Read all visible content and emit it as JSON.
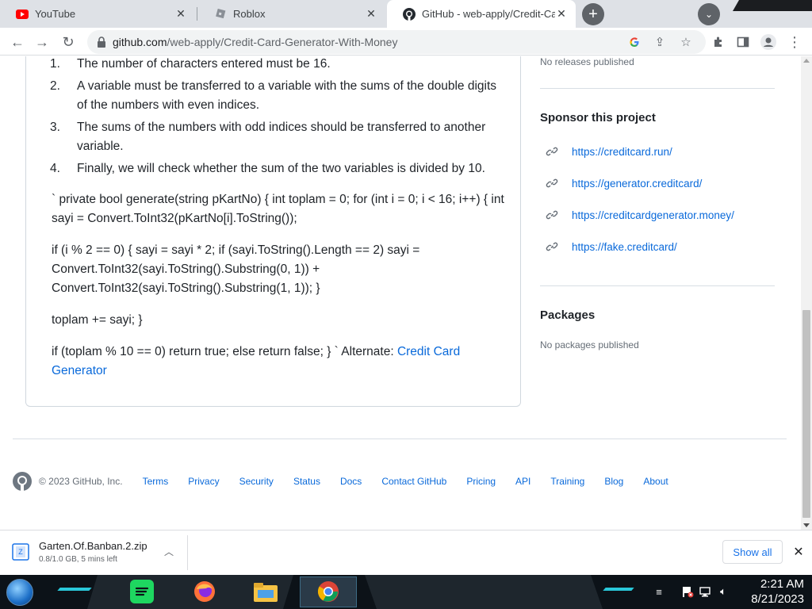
{
  "browser": {
    "tabs": [
      {
        "title": "YouTube",
        "icon": "youtube-icon"
      },
      {
        "title": "Roblox",
        "icon": "roblox-icon"
      },
      {
        "title": "GitHub - web-apply/Credit-Card-",
        "icon": "github-icon",
        "active": true
      }
    ],
    "url_host": "github.com",
    "url_path": "/web-apply/Credit-Card-Generator-With-Money"
  },
  "readme": {
    "steps": [
      {
        "num": "1.",
        "text": "The number of characters entered must be 16."
      },
      {
        "num": "2.",
        "text": "A variable must be transferred to a variable with the sums of the double digits of the numbers with even indices."
      },
      {
        "num": "3.",
        "text": "The sums of the numbers with odd indices should be transferred to another variable."
      },
      {
        "num": "4.",
        "text": "Finally, we will check whether the sum of the two variables is divided by 10."
      }
    ],
    "code_para_1": "` private bool generate(string pKartNo) { int toplam = 0; for (int i = 0; i < 16; i++) { int sayi = Convert.ToInt32(pKartNo[i].ToString());",
    "code_para_2": "if (i % 2 == 0) { sayi = sayi * 2; if (sayi.ToString().Length == 2) sayi = Convert.ToInt32(sayi.ToString().Substring(0, 1)) + Convert.ToInt32(sayi.ToString().Substring(1, 1)); }",
    "code_para_3": "toplam += sayi; }",
    "code_para_4_text": "if (toplam % 10 == 0) return true; else return false; } ` Alternate: ",
    "code_para_4_link": "Credit Card Generator"
  },
  "sidebar": {
    "releases_text": "No releases published",
    "sponsor_heading": "Sponsor this project",
    "sponsor_links": [
      "https://creditcard.run/",
      "https://generator.creditcard/",
      "https://creditcardgenerator.money/",
      "https://fake.creditcard/"
    ],
    "packages_heading": "Packages",
    "packages_text": "No packages published"
  },
  "footer": {
    "copyright": "© 2023 GitHub, Inc.",
    "links": [
      "Terms",
      "Privacy",
      "Security",
      "Status",
      "Docs",
      "Contact GitHub",
      "Pricing",
      "API",
      "Training",
      "Blog",
      "About"
    ]
  },
  "download": {
    "filename": "Garten.Of.Banban.2.zip",
    "status": "0.8/1.0 GB, 5 mins left",
    "show_all": "Show all"
  },
  "taskbar": {
    "time": "2:21 AM",
    "date": "8/21/2023"
  },
  "colors": {
    "link": "#0969da",
    "chrome_accent": "#1a73e8",
    "taskbar_accent": "#29c7d9"
  }
}
